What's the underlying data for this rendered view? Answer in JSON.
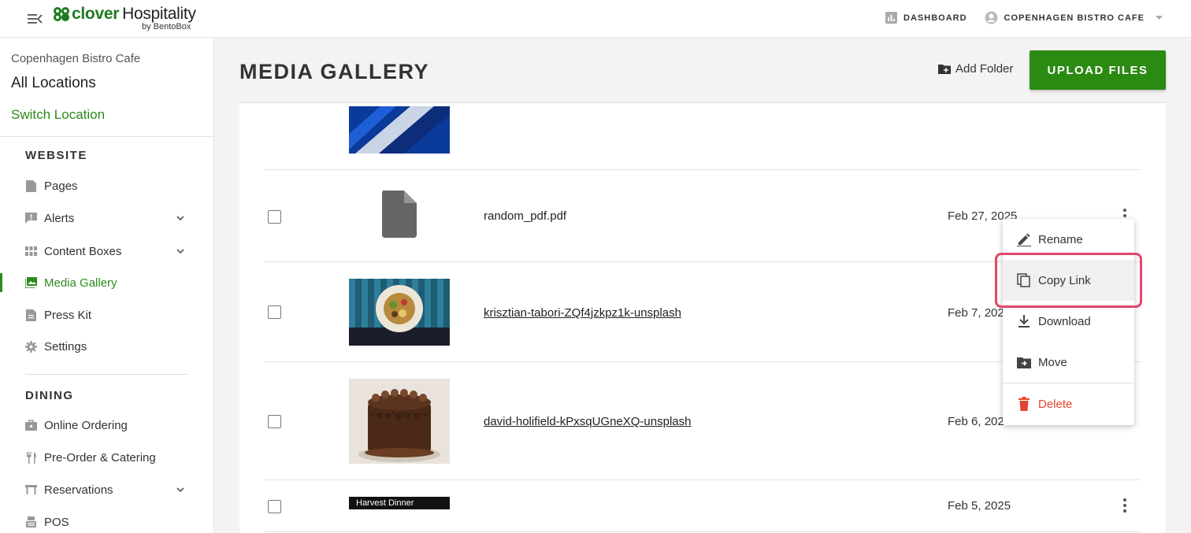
{
  "header": {
    "brand_name": "clover",
    "brand_suffix": "Hospitality",
    "brand_sub": "by BentoBox",
    "dashboard_label": "DASHBOARD",
    "account_label": "COPENHAGEN BISTRO CAFE"
  },
  "sidebar": {
    "location_name": "Copenhagen Bistro Cafe",
    "location_scope": "All Locations",
    "switch_label": "Switch Location",
    "website_title": "WEBSITE",
    "website_items": [
      {
        "label": "Pages",
        "icon": "page-icon",
        "expandable": false
      },
      {
        "label": "Alerts",
        "icon": "alert-icon",
        "expandable": true
      },
      {
        "label": "Content Boxes",
        "icon": "grid-icon",
        "expandable": true
      },
      {
        "label": "Media Gallery",
        "icon": "image-icon",
        "expandable": false,
        "active": true
      },
      {
        "label": "Press Kit",
        "icon": "document-icon",
        "expandable": false
      },
      {
        "label": "Settings",
        "icon": "gear-icon",
        "expandable": false
      }
    ],
    "dining_title": "DINING",
    "dining_items": [
      {
        "label": "Online Ordering",
        "icon": "bag-icon",
        "expandable": false
      },
      {
        "label": "Pre-Order & Catering",
        "icon": "utensils-icon",
        "expandable": false
      },
      {
        "label": "Reservations",
        "icon": "table-icon",
        "expandable": true
      },
      {
        "label": "POS",
        "icon": "register-icon",
        "expandable": false
      }
    ]
  },
  "main": {
    "title": "MEDIA GALLERY",
    "add_folder_label": "Add Folder",
    "upload_label": "UPLOAD FILES",
    "files": [
      {
        "name": "",
        "date": "",
        "thumb": "blue-stripe"
      },
      {
        "name": "random_pdf.pdf",
        "date": "Feb 27, 2025",
        "thumb": "file-icon"
      },
      {
        "name": "krisztian-tabori-ZQf4jzkpz1k-unsplash",
        "date": "Feb 7, 2025",
        "thumb": "food-plate"
      },
      {
        "name": "david-holifield-kPxsqUGneXQ-unsplash",
        "date": "Feb 6, 2025",
        "thumb": "chocolate-cake"
      },
      {
        "name": "",
        "date": "Feb 5, 2025",
        "thumb": "harvest-banner",
        "thumb_text": "Harvest Dinner"
      }
    ]
  },
  "context_menu": {
    "items": [
      {
        "label": "Rename",
        "icon": "pencil-icon"
      },
      {
        "label": "Copy Link",
        "icon": "copy-icon"
      },
      {
        "label": "Download",
        "icon": "download-icon"
      },
      {
        "label": "Move",
        "icon": "folder-move-icon"
      },
      {
        "label": "Delete",
        "icon": "trash-icon"
      }
    ]
  },
  "colors": {
    "brand_green": "#2a8a12",
    "active_green": "#2d8a1e",
    "danger_red": "#e3452f",
    "highlight_pink": "#e0486a"
  }
}
